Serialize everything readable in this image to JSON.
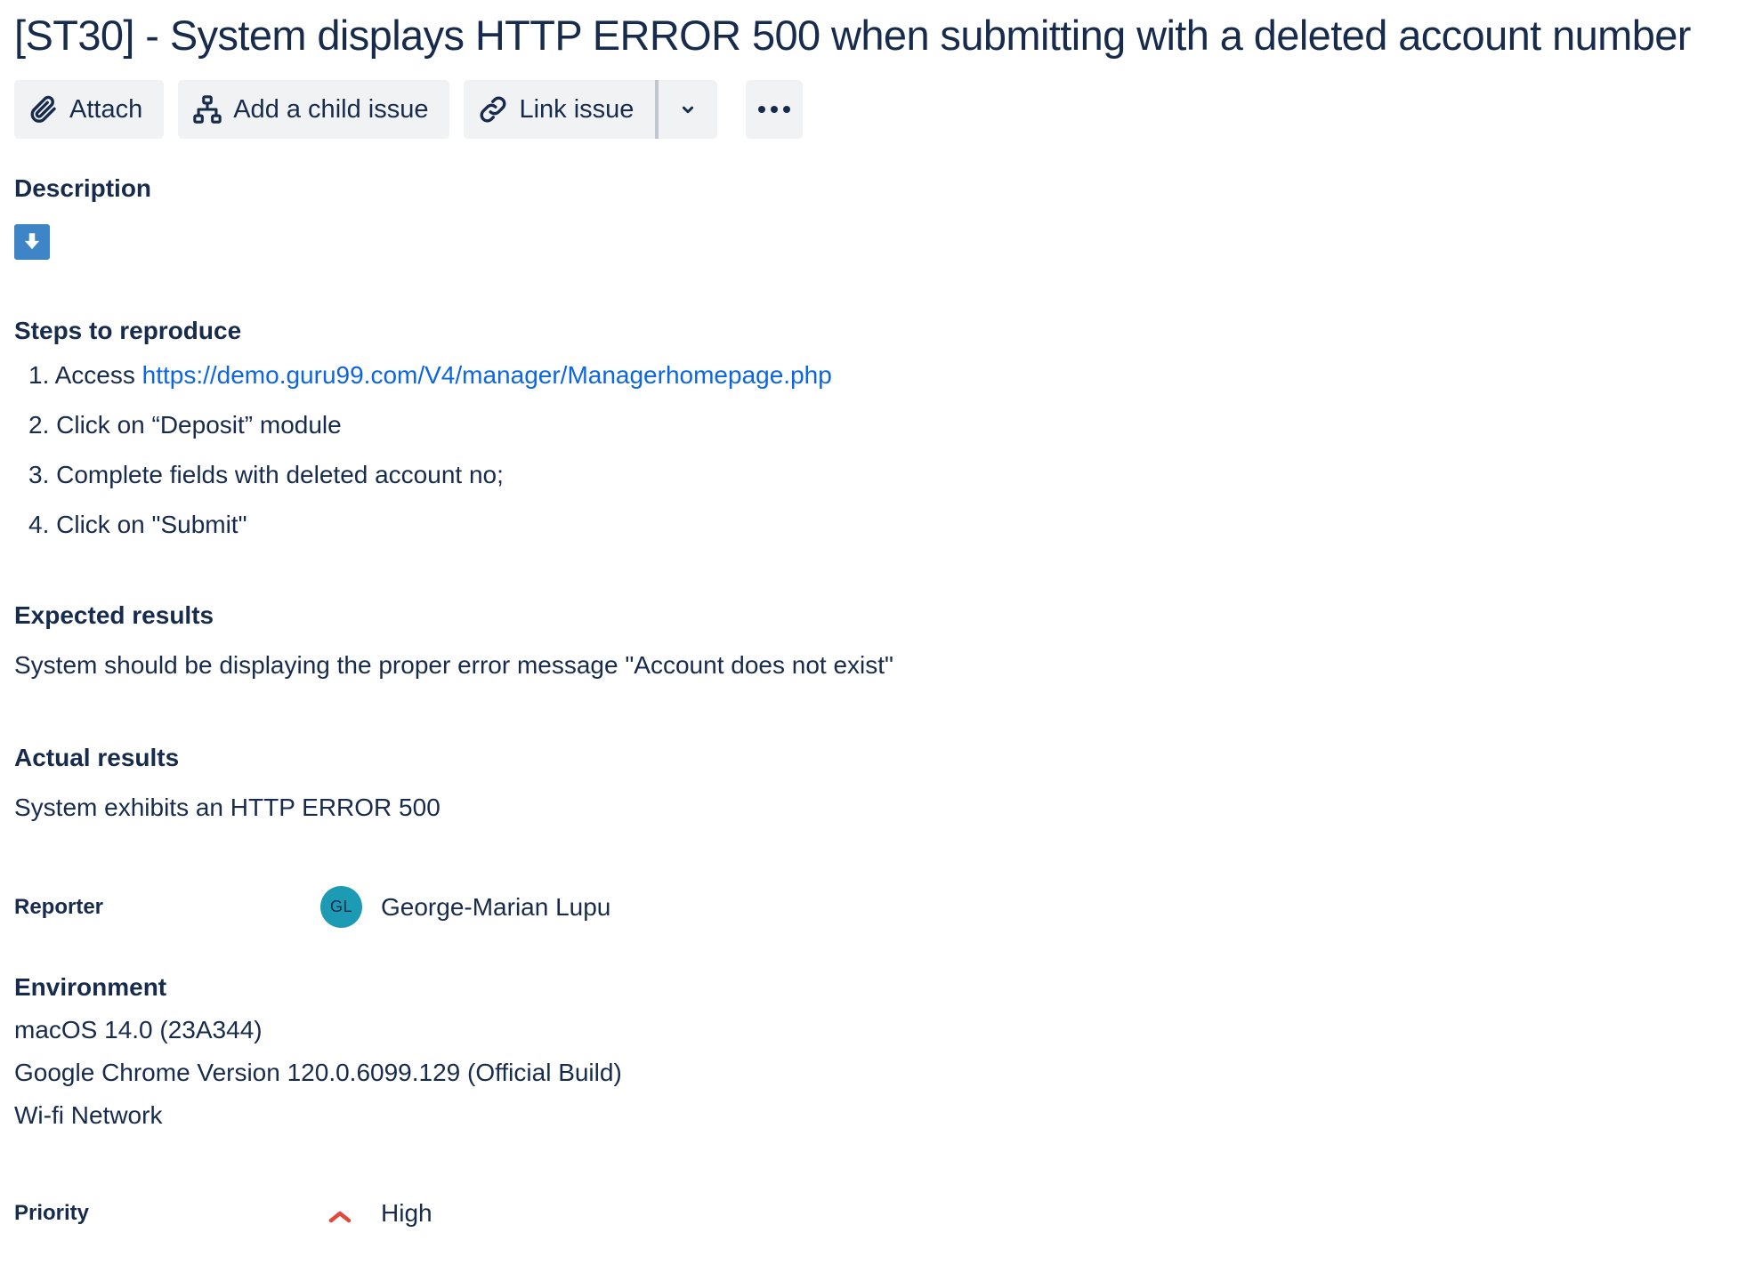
{
  "issue": {
    "title": "[ST30] - System displays HTTP ERROR 500 when submitting with a deleted account number"
  },
  "toolbar": {
    "attach_label": "Attach",
    "child_label": "Add a child issue",
    "link_label": "Link issue"
  },
  "description": {
    "heading": "Description",
    "steps_heading": "Steps to reproduce",
    "steps": [
      {
        "num": "1.",
        "prefix": "Access ",
        "link": "https://demo.guru99.com/V4/manager/Managerhomepage.php"
      },
      {
        "num": "2.",
        "text": "Click on “Deposit” module"
      },
      {
        "num": "3.",
        "text": "Complete fields with deleted account no;"
      },
      {
        "num": "4.",
        "text": "Click on \"Submit\""
      }
    ],
    "expected_heading": "Expected results",
    "expected_text": "System should be displaying the proper error message \"Account does not exist\"",
    "actual_heading": "Actual results",
    "actual_text": "System exhibits an HTTP ERROR 500"
  },
  "reporter": {
    "label": "Reporter",
    "initials": "GL",
    "name": "George-Marian Lupu"
  },
  "environment": {
    "heading": "Environment",
    "lines": [
      "macOS 14.0 (23A344)",
      "Google Chrome Version 120.0.6099.129 (Official Build)",
      "Wi-fi Network"
    ]
  },
  "priority": {
    "label": "Priority",
    "value": "High"
  },
  "colors": {
    "text": "#172b4d",
    "link": "#0c66e4",
    "button_bg": "#f1f2f4",
    "download_icon": "#3d85c6",
    "avatar": "#1d9bb5",
    "priority_high": "#e2483d"
  },
  "icons": [
    "paperclip-icon",
    "hierarchy-icon",
    "link-icon",
    "chevron-down-icon",
    "more-icon",
    "download-icon",
    "priority-high-icon"
  ]
}
